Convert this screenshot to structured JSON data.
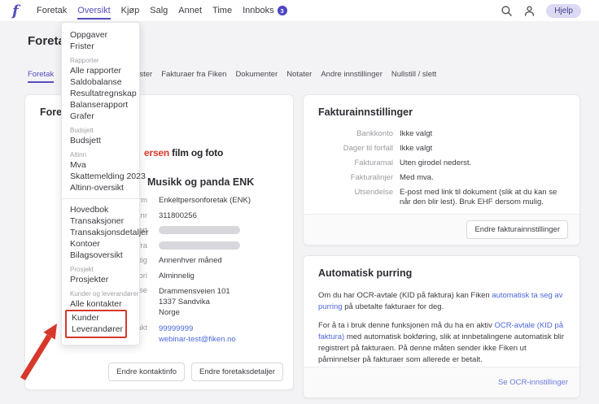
{
  "colors": {
    "accent": "#564dbe",
    "link": "#4c68d9",
    "annotation_red": "#d6392b",
    "badge": "#4d45c4"
  },
  "topbar": {
    "nav": [
      {
        "label": "Foretak"
      },
      {
        "label": "Oversikt",
        "active": true
      },
      {
        "label": "Kjøp"
      },
      {
        "label": "Salg"
      },
      {
        "label": "Annet"
      },
      {
        "label": "Time"
      },
      {
        "label": "Innboks",
        "badge": "3"
      }
    ],
    "help_label": "Hjelp"
  },
  "page": {
    "title": "Foretak"
  },
  "tabs": [
    {
      "label": "Foretak",
      "active": true
    },
    {
      "label": "Regnskapstjenester"
    },
    {
      "label": "Fakturaer fra Fiken"
    },
    {
      "label": "Dokumenter"
    },
    {
      "label": "Notater"
    },
    {
      "label": "Andre innstillinger"
    },
    {
      "label": "Nullstill / slett"
    }
  ],
  "dropdown": {
    "entries": [
      {
        "type": "item",
        "label": "Oppgaver"
      },
      {
        "type": "item",
        "label": "Frister"
      },
      {
        "type": "header",
        "label": "Rapporter"
      },
      {
        "type": "item",
        "label": "Alle rapporter"
      },
      {
        "type": "item",
        "label": "Saldobalanse"
      },
      {
        "type": "item",
        "label": "Resultatregnskap"
      },
      {
        "type": "item",
        "label": "Balanserapport"
      },
      {
        "type": "item",
        "label": "Grafer"
      },
      {
        "type": "header",
        "label": "Budsjett"
      },
      {
        "type": "item",
        "label": "Budsjett"
      },
      {
        "type": "header",
        "label": "Altinn"
      },
      {
        "type": "item",
        "label": "Mva"
      },
      {
        "type": "item",
        "label": "Skattemelding 2023"
      },
      {
        "type": "item",
        "label": "Altinn-oversikt"
      },
      {
        "type": "divider"
      },
      {
        "type": "item",
        "label": "Hovedbok"
      },
      {
        "type": "item",
        "label": "Transaksjoner"
      },
      {
        "type": "item",
        "label": "Transaksjonsdetaljer"
      },
      {
        "type": "item",
        "label": "Kontoer"
      },
      {
        "type": "item",
        "label": "Bilagsoversikt"
      },
      {
        "type": "header",
        "label": "Prosjekt"
      },
      {
        "type": "item",
        "label": "Prosjekter"
      },
      {
        "type": "header",
        "label": "Kunder og leverandører"
      },
      {
        "type": "item",
        "label": "Alle kontakter"
      },
      {
        "type": "item",
        "label": "Kunder",
        "boxed": true
      },
      {
        "type": "item",
        "label": "Leverandører",
        "boxed": true
      }
    ]
  },
  "company_card": {
    "title": "Foretaksinfo",
    "logo": {
      "red": "ersen",
      "rest": " film og foto"
    },
    "company_name": "Musikk og panda ENK",
    "fields": [
      {
        "label": "Selskapsform",
        "value": "Enkeltpersonforetak (ENK)"
      },
      {
        "label": "Organisasjonsnr",
        "value": "311800256"
      },
      {
        "label": "Etablert",
        "redacted": true
      },
      {
        "label": "I Fiken fra",
        "redacted": true
      },
      {
        "label": "Mva-pliktig",
        "value": "Annenhver måned"
      },
      {
        "label": "Kategori",
        "value": "Alminnelig"
      },
      {
        "label": "Adresse",
        "lines": [
          "Drammensveien 101",
          "1337 Sandvika",
          "Norge"
        ]
      },
      {
        "label": "Kontakt",
        "links": [
          "99999999",
          "webinar-test@fiken.no"
        ]
      }
    ],
    "buttons": [
      "Endre kontaktinfo",
      "Endre foretaksdetaljer"
    ]
  },
  "invoice_card": {
    "title": "Fakturainnstillinger",
    "rows": [
      {
        "label": "Bankkonto",
        "value": "Ikke valgt"
      },
      {
        "label": "Dager til forfall",
        "value": "Ikke valgt"
      },
      {
        "label": "Fakturamal",
        "value": "Uten girodel nederst."
      },
      {
        "label": "Fakturalinjer",
        "value": "Med mva."
      },
      {
        "label": "Utsendelse",
        "value": "E-post med link til dokument (slik at du kan se når den blir lest). Bruk EHF dersom mulig."
      }
    ],
    "button": "Endre fakturainnstillinger"
  },
  "dunning_card": {
    "title": "Automatisk purring",
    "paragraphs": [
      [
        {
          "text": "Om du har OCR-avtale (KID på faktura) kan Fiken "
        },
        {
          "text": "automatisk ta seg av purring",
          "link": true
        },
        {
          "text": " på ubetalte fakturaer for deg."
        }
      ],
      [
        {
          "text": "For å ta i bruk denne funksjonen må du ha en aktiv "
        },
        {
          "text": "OCR-avtale (KID på faktura)",
          "link": true
        },
        {
          "text": " med automatisk bokføring, slik at innbetalingene automatisk blir registrert på fakturaen. På denne måten sender ikke Fiken ut påminnelser på fakturaer som allerede er betalt."
        }
      ]
    ],
    "footer_link": "Se OCR-innstillinger"
  }
}
